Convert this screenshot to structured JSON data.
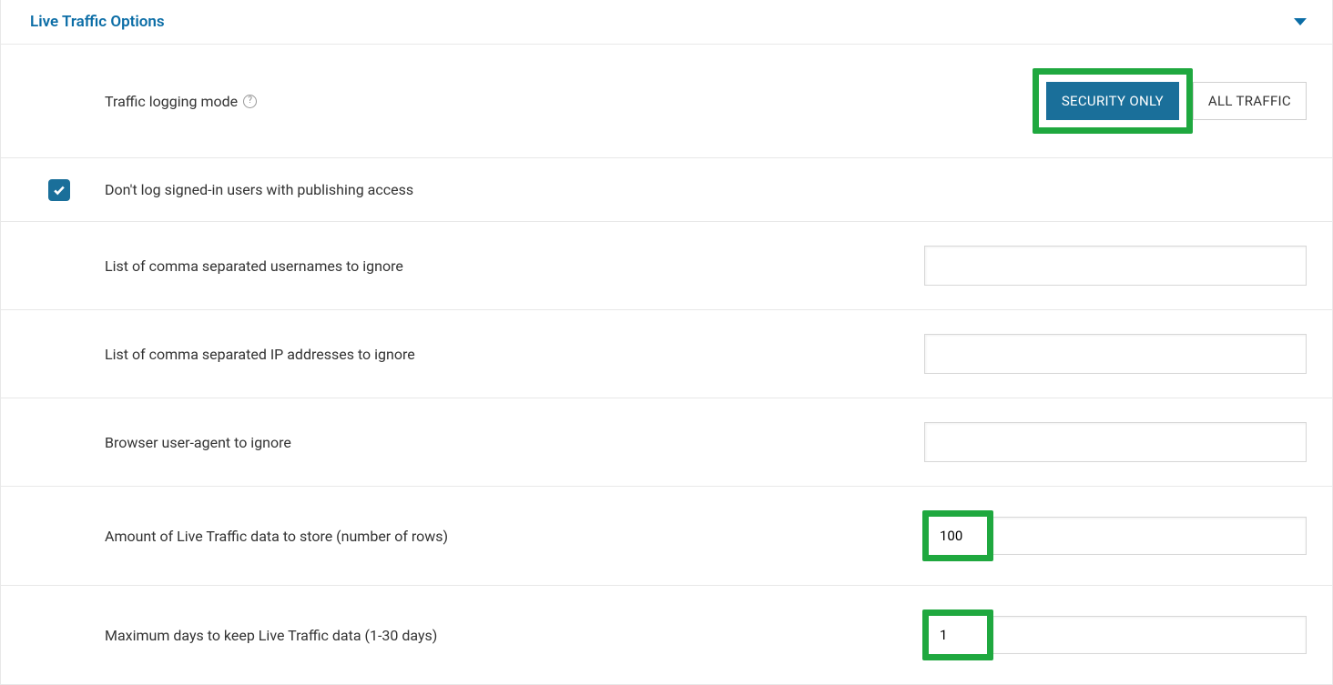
{
  "header": {
    "title": "Live Traffic Options"
  },
  "rows": {
    "logging_mode": {
      "label": "Traffic logging mode",
      "options": {
        "security": "SECURITY ONLY",
        "all": "ALL TRAFFIC"
      }
    },
    "dont_log_publishers": {
      "label": "Don't log signed-in users with publishing access",
      "checked": true
    },
    "ignore_usernames": {
      "label": "List of comma separated usernames to ignore",
      "value": ""
    },
    "ignore_ips": {
      "label": "List of comma separated IP addresses to ignore",
      "value": ""
    },
    "ignore_ua": {
      "label": "Browser user-agent to ignore",
      "value": ""
    },
    "rows_store": {
      "label": "Amount of Live Traffic data to store (number of rows)",
      "value": "100"
    },
    "max_days": {
      "label": "Maximum days to keep Live Traffic data (1-30 days)",
      "value": "1"
    }
  }
}
